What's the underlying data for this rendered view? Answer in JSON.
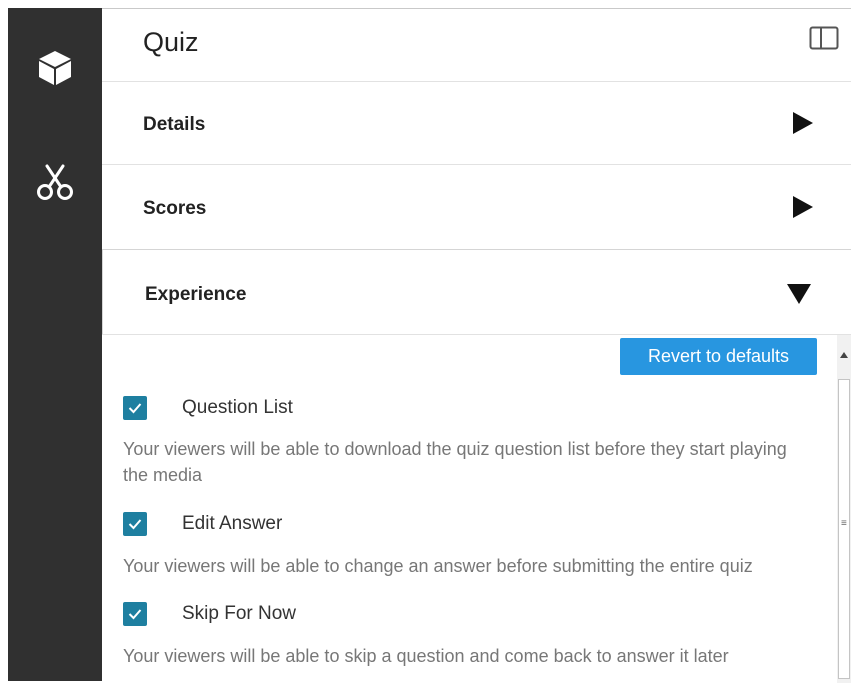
{
  "sidebar": {
    "items": [
      {
        "icon": "cube-icon"
      },
      {
        "icon": "scissors-icon"
      }
    ]
  },
  "header": {
    "title": "Quiz",
    "toggle_icon": "split-panel-icon"
  },
  "sections": [
    {
      "label": "Details",
      "state": "collapsed"
    },
    {
      "label": "Scores",
      "state": "collapsed"
    },
    {
      "label": "Experience",
      "state": "expanded"
    }
  ],
  "experience": {
    "revert_label": "Revert to defaults",
    "options": [
      {
        "label": "Question List",
        "checked": true,
        "description": "Your viewers will be able to download the quiz question list before they start playing the media"
      },
      {
        "label": "Edit Answer",
        "checked": true,
        "description": "Your viewers will be able to change an answer before submitting the entire quiz"
      },
      {
        "label": "Skip For Now",
        "checked": true,
        "description": "Your viewers will be able to skip a question and come back to answer it later"
      }
    ]
  },
  "colors": {
    "sidebar": "#303030",
    "accent": "#2896e0",
    "checkbox": "#1e7fa0",
    "muted_text": "#777777"
  }
}
